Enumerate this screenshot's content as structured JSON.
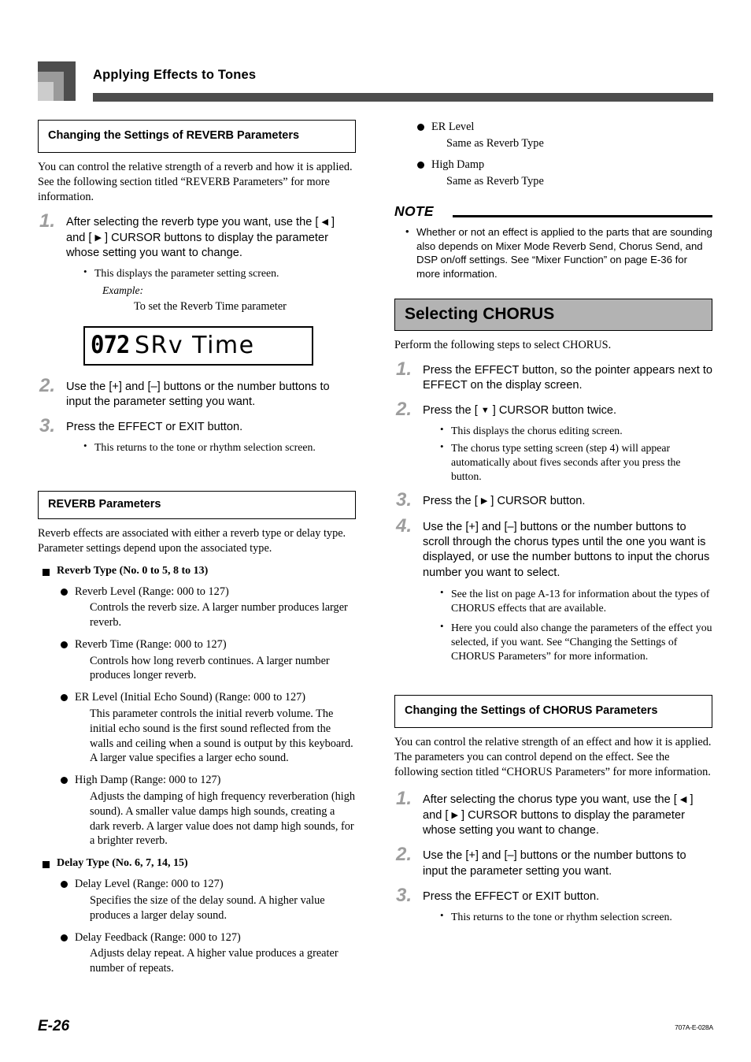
{
  "header": {
    "title": "Applying Effects to Tones"
  },
  "left_column": {
    "reverb_settings_heading": "Changing the Settings of REVERB Parameters",
    "reverb_intro": "You can control the relative strength of a reverb and how it is applied. See the following section titled “REVERB Parameters” for more information.",
    "steps": [
      {
        "num": "1.",
        "text_a": "After selecting the reverb type you want, use the [ ",
        "arrow_left": "◀",
        "text_b": " ] and [ ",
        "arrow_right": "▶",
        "text_c": " ] CURSOR buttons to display the parameter whose setting you want to change.",
        "bullets": [
          "This displays the parameter setting screen."
        ],
        "example_label": "Example:",
        "example_text": "To set the Reverb Time parameter"
      },
      {
        "num": "2.",
        "text": "Use the [+] and [–] buttons or the number buttons to input the parameter setting you want."
      },
      {
        "num": "3.",
        "text": "Press the EFFECT or EXIT button.",
        "bullets": [
          "This returns to the tone or rhythm selection screen."
        ]
      }
    ],
    "lcd": {
      "digits": "072",
      "text": "SRv Time"
    },
    "reverb_params_heading": "REVERB Parameters",
    "reverb_params_intro": "Reverb effects are associated with either a reverb type or delay type. Parameter settings depend upon the associated type.",
    "groups": [
      {
        "title": "Reverb Type (No. 0 to 5, 8 to 13)",
        "items": [
          {
            "name": "Reverb Level (Range: 000 to 127)",
            "desc": "Controls the reverb size.  A larger number produces larger reverb."
          },
          {
            "name": "Reverb Time (Range: 000 to 127)",
            "desc": "Controls how long reverb continues.  A larger number produces longer reverb."
          },
          {
            "name": "ER Level (Initial Echo Sound) (Range: 000 to 127)",
            "desc": "This parameter controls the initial reverb volume. The initial echo sound is the first sound reflected from the walls and ceiling when a sound is output by this keyboard. A larger value specifies a larger echo sound."
          },
          {
            "name": "High Damp (Range: 000 to 127)",
            "desc": "Adjusts the damping of high frequency reverberation (high sound). A smaller value damps high sounds, creating a dark reverb. A larger value does not damp high sounds, for a brighter reverb."
          }
        ]
      },
      {
        "title": "Delay Type (No. 6, 7, 14, 15)",
        "items": [
          {
            "name": "Delay Level (Range: 000 to 127)",
            "desc": "Specifies the size of the delay sound. A higher value produces a larger delay sound."
          },
          {
            "name": "Delay Feedback (Range: 000 to 127)",
            "desc": "Adjusts delay repeat. A higher value produces a greater number of repeats."
          }
        ]
      }
    ]
  },
  "right_column": {
    "continued_items": [
      {
        "name": "ER Level",
        "desc": "Same as Reverb Type"
      },
      {
        "name": "High Damp",
        "desc": "Same as Reverb Type"
      }
    ],
    "note": {
      "label": "NOTE",
      "bullets": [
        "Whether or not an effect is applied to the parts that are sounding also depends on Mixer Mode Reverb Send, Chorus Send, and DSP on/off settings. See “Mixer Function” on page E-36 for more information."
      ]
    },
    "chorus_banner": "Selecting CHORUS",
    "chorus_intro": "Perform the following steps to select CHORUS.",
    "chorus_steps": [
      {
        "num": "1.",
        "text": "Press the EFFECT button, so the pointer appears next to EFFECT on the display screen."
      },
      {
        "num": "2.",
        "text_a": "Press the [ ",
        "arrow_down": "▼",
        "text_b": " ] CURSOR button twice.",
        "bullets": [
          "This displays the chorus editing screen.",
          "The chorus type setting screen (step 4) will appear automatically about fives seconds after you press the button."
        ]
      },
      {
        "num": "3.",
        "text_a": "Press the [ ",
        "arrow_right": "▶",
        "text_b": " ] CURSOR button."
      },
      {
        "num": "4.",
        "text": "Use the [+] and [–] buttons or the number buttons to scroll through the chorus types until the one you want is displayed, or use the number buttons to input the chorus number you want to select.",
        "bullets": [
          "See the list on page A-13 for information about the types of CHORUS effects that are available.",
          "Here you could also change the parameters of the effect you selected, if you want. See “Changing the Settings of CHORUS Parameters” for more information."
        ]
      }
    ],
    "chorus_settings_heading": "Changing the Settings of CHORUS Parameters",
    "chorus_settings_intro": "You can control the relative strength of an effect and how it is applied. The parameters you can control depend on the effect. See the following section titled “CHORUS Parameters” for more information.",
    "chorus_settings_steps": [
      {
        "num": "1.",
        "text_a": "After selecting the chorus type you want, use the [ ",
        "arrow_left": "◀",
        "text_b": " ] and [ ",
        "arrow_right": "▶",
        "text_c": " ] CURSOR buttons to display the parameter whose setting you want to change."
      },
      {
        "num": "2.",
        "text": "Use the [+] and [–] buttons or the number buttons to input the parameter setting you want."
      },
      {
        "num": "3.",
        "text": "Press the EFFECT or EXIT button.",
        "bullets": [
          "This returns to the tone or rhythm selection screen."
        ]
      }
    ]
  },
  "footer": {
    "page_number": "E-26",
    "doc_code": "707A-E-028A"
  }
}
